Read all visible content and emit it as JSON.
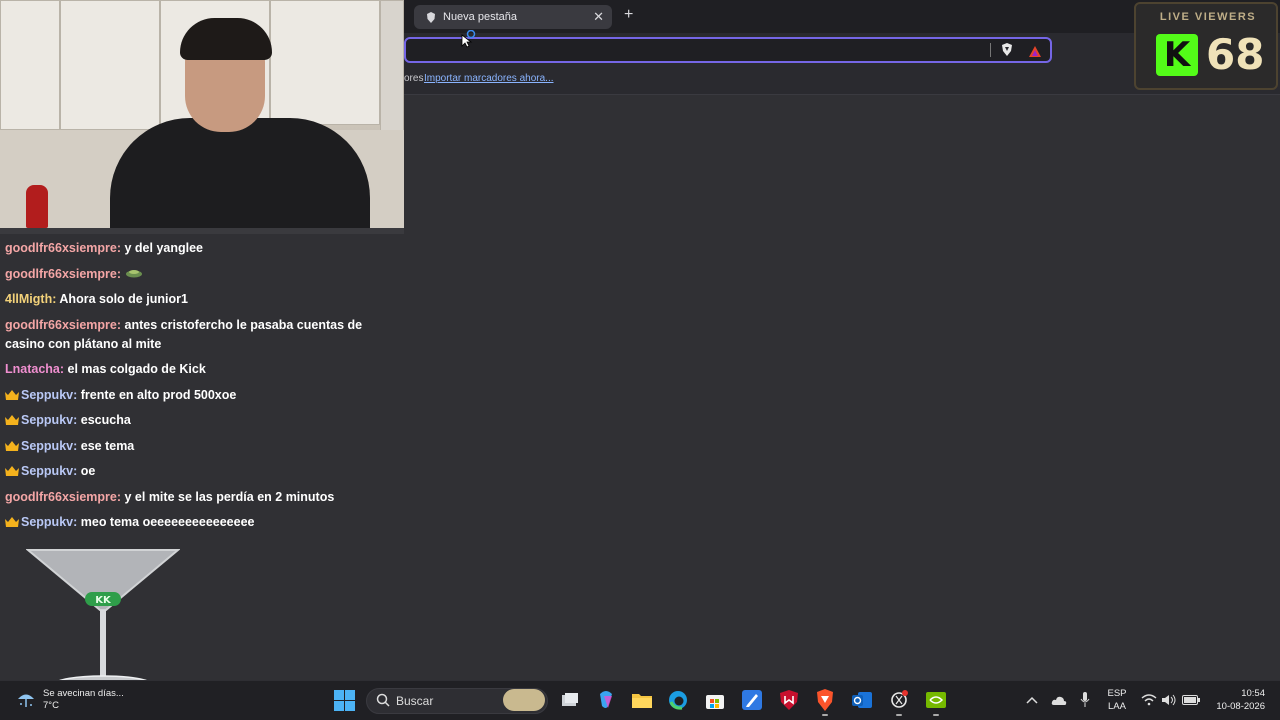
{
  "browser": {
    "tab_title": "Nueva pestaña",
    "close_glyph": "✕",
    "new_tab_glyph": "+",
    "bookmarks_prefix": "ores",
    "bookmarks_import_link": "Importar marcadores ahora..."
  },
  "chat": {
    "messages": [
      {
        "user": "goodlfr66xsiempre:",
        "text": "y del yanglee",
        "color": "#f4a6a6",
        "crown": false
      },
      {
        "user": "goodlfr66xsiempre:",
        "text": "",
        "color": "#f4a6a6",
        "crown": false,
        "emote": "emote-icon"
      },
      {
        "user": "4llMigth:",
        "text": "Ahora solo de junior1",
        "color": "#f3d27a",
        "crown": false
      },
      {
        "user": "goodlfr66xsiempre:",
        "text": "antes cristofercho le pasaba cuentas de casino con plátano al mite",
        "color": "#f4a6a6",
        "crown": false
      },
      {
        "user": "Lnatacha:",
        "text": "el mas colgado de Kick",
        "color": "#f08fd0",
        "crown": false
      },
      {
        "user": "Seppukv:",
        "text": "frente en alto prod 500xoe",
        "color": "#b9c8f5",
        "crown": true
      },
      {
        "user": "Seppukv:",
        "text": "escucha",
        "color": "#b9c8f5",
        "crown": true
      },
      {
        "user": "Seppukv:",
        "text": "ese tema",
        "color": "#b9c8f5",
        "crown": true
      },
      {
        "user": "Seppukv:",
        "text": "oe",
        "color": "#b9c8f5",
        "crown": true
      },
      {
        "user": "goodlfr66xsiempre:",
        "text": "y el mite se las perdía en 2 minutos",
        "color": "#f4a6a6",
        "crown": false
      },
      {
        "user": "Seppukv:",
        "text": "meo tema oeeeeeeeeeeeeeee",
        "color": "#b9c8f5",
        "crown": true
      }
    ]
  },
  "viewers_widget": {
    "title": "LIVE VIEWERS",
    "logo_letter": "K",
    "count": "68",
    "logo_color": "#53fc18"
  },
  "taskbar": {
    "weather_line1": "Se avecinan días...",
    "weather_line2": "7°C",
    "search_label": "Buscar",
    "lang_line1": "ESP",
    "lang_line2": "LAA",
    "time": "10:54",
    "date": "10-08-2026"
  }
}
